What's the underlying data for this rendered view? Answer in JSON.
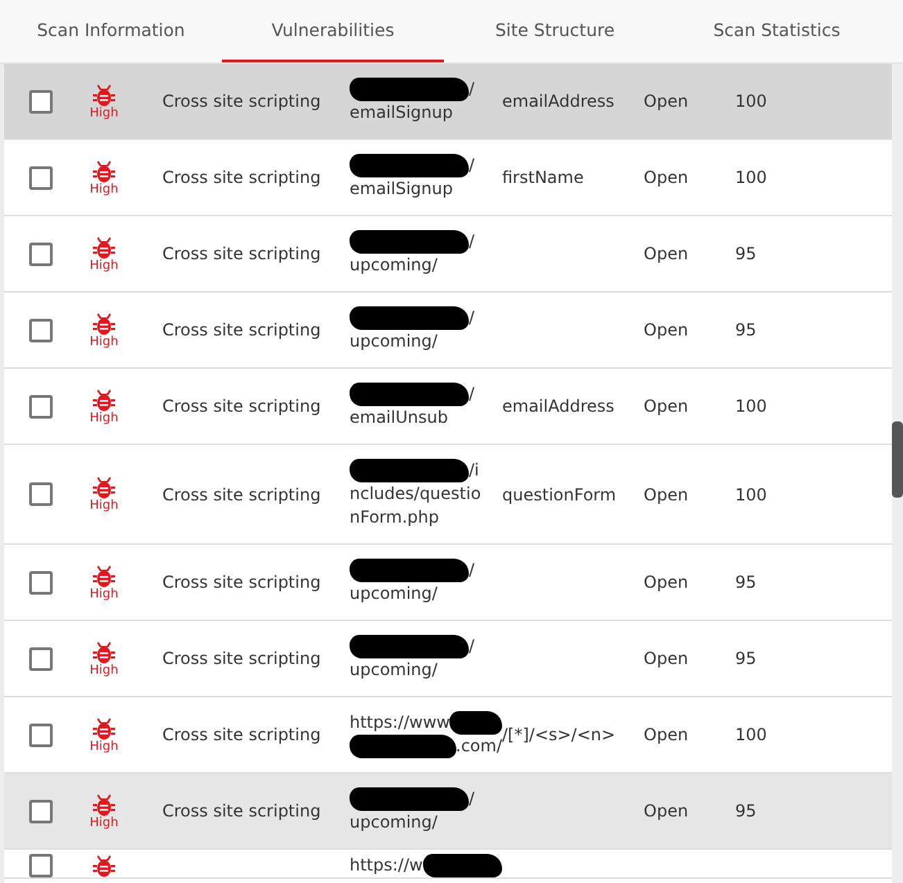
{
  "tabs": [
    {
      "label": "Scan Information",
      "selected": false
    },
    {
      "label": "Vulnerabilities",
      "selected": true
    },
    {
      "label": "Site Structure",
      "selected": false
    },
    {
      "label": "Scan Statistics",
      "selected": false
    }
  ],
  "rows": [
    {
      "checked": false,
      "selected": true,
      "highlighted": true,
      "severity": "High",
      "name": "Cross site scripting",
      "url": [
        {
          "redacted": true,
          "after": "/"
        },
        {
          "text": "emailSignup"
        }
      ],
      "parameter": "emailAddress",
      "status": "Open",
      "score": "100"
    },
    {
      "checked": false,
      "selected": false,
      "highlighted": false,
      "severity": "High",
      "name": "Cross site scripting",
      "url": [
        {
          "redacted": true,
          "after": "/"
        },
        {
          "text": "emailSignup"
        }
      ],
      "parameter": "firstName",
      "status": "Open",
      "score": "100"
    },
    {
      "checked": false,
      "selected": false,
      "highlighted": false,
      "severity": "High",
      "name": "Cross site scripting",
      "url": [
        {
          "redacted": true,
          "after": "/"
        },
        {
          "text": "upcoming/"
        }
      ],
      "status": "Open",
      "score": "95"
    },
    {
      "checked": false,
      "selected": false,
      "highlighted": false,
      "severity": "High",
      "name": "Cross site scripting",
      "url": [
        {
          "redacted": true,
          "after": "/"
        },
        {
          "text": "upcoming/"
        }
      ],
      "status": "Open",
      "score": "95"
    },
    {
      "checked": false,
      "selected": false,
      "highlighted": false,
      "severity": "High",
      "name": "Cross site scripting",
      "url": [
        {
          "redacted": true,
          "after": "/"
        },
        {
          "text": "emailUnsub"
        }
      ],
      "parameter": "emailAddress",
      "status": "Open",
      "score": "100"
    },
    {
      "checked": false,
      "selected": false,
      "highlighted": false,
      "severity": "High",
      "name": "Cross site scripting",
      "url": [
        {
          "redacted": true,
          "after": "/i"
        },
        {
          "text": "ncludes/questio"
        },
        {
          "text": "nForm.php"
        }
      ],
      "parameter": "questionForm",
      "status": "Open",
      "score": "100"
    },
    {
      "checked": false,
      "selected": false,
      "highlighted": false,
      "severity": "High",
      "name": "Cross site scripting",
      "url": [
        {
          "redacted": true,
          "after": "/"
        },
        {
          "text": "upcoming/"
        }
      ],
      "status": "Open",
      "score": "95"
    },
    {
      "checked": false,
      "selected": false,
      "highlighted": false,
      "severity": "High",
      "name": "Cross site scripting",
      "url": [
        {
          "redacted": true,
          "after": "/"
        },
        {
          "text": "upcoming/"
        }
      ],
      "status": "Open",
      "score": "95"
    },
    {
      "checked": false,
      "selected": false,
      "highlighted": false,
      "severity": "High",
      "name": "Cross site scripting",
      "url": [
        {
          "text": "https://www",
          "redacted": true
        },
        {
          "redacted": true,
          "after": ".com/"
        }
      ],
      "parameter": "/[*]/<s>/<n>",
      "status": "Open",
      "score": "100"
    },
    {
      "checked": false,
      "selected": false,
      "highlighted": true,
      "severity": "High",
      "name": "Cross site scripting",
      "url": [
        {
          "redacted": true,
          "after": "/"
        },
        {
          "text": "upcoming/"
        }
      ],
      "status": "Open",
      "score": "95"
    },
    {
      "checked": false,
      "selected": false,
      "highlighted": false,
      "url": [
        {
          "text": "https://w",
          "redacted": true
        }
      ]
    }
  ]
}
